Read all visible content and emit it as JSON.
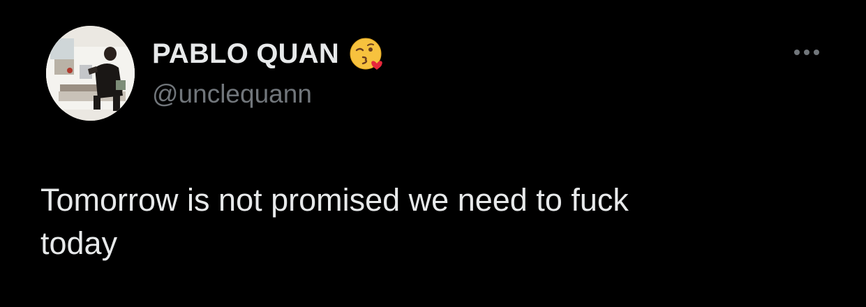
{
  "tweet": {
    "author": {
      "display_name": "PABLO QUAN",
      "handle": "@unclequann",
      "name_emoji": "face-blowing-a-kiss"
    },
    "text": "Tomorrow is not promised we need to fuck\ntoday",
    "more_icon": "more-horizontal-icon"
  },
  "colors": {
    "background": "#000000",
    "primary_text": "#e7e9ea",
    "secondary_text": "#71767b"
  }
}
